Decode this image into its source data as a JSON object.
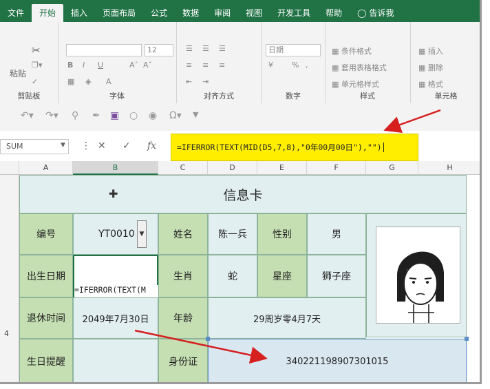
{
  "ribbon": {
    "tabs": [
      "文件",
      "开始",
      "插入",
      "页面布局",
      "公式",
      "数据",
      "审阅",
      "视图",
      "开发工具",
      "帮助",
      "告诉我"
    ],
    "active_tab": "开始",
    "groups": {
      "clipboard": "剪贴板",
      "font": "字体",
      "alignment": "对齐方式",
      "number": "数字",
      "styles": "样式",
      "cells": "单元格"
    },
    "paste_label": "粘贴",
    "font_size": "12",
    "number_format": "日期",
    "conditional_format": "条件格式",
    "table_format": "套用表格格式",
    "cell_styles": "单元格样式",
    "insert": "插入",
    "delete": "删除",
    "format": "格式"
  },
  "formula_bar": {
    "name_box": "SUM",
    "formula": "=IFERROR(TEXT(MID(D5,7,8),\"0年00月00日\"),\"\")"
  },
  "columns": [
    "A",
    "B",
    "C",
    "D",
    "E",
    "F",
    "G",
    "H"
  ],
  "row_number_partial": "4",
  "card": {
    "title": "信息卡",
    "labels": {
      "id_no": "编号",
      "name": "姓名",
      "gender": "性别",
      "birth": "出生日期",
      "zodiac": "生肖",
      "constellation": "星座",
      "retire": "退休时间",
      "age": "年龄",
      "reminder": "生日提醒",
      "id_card": "身份证"
    },
    "values": {
      "id_no": "YT0010",
      "name": "陈一兵",
      "gender": "男",
      "birth_formula": "=IFERROR(TEXT(M",
      "zodiac": "蛇",
      "constellation": "狮子座",
      "retire": "2049年7月30日",
      "age": "29周岁零4月7天",
      "id_card": "340221198907301015"
    }
  },
  "colors": {
    "ribbon": "#217346",
    "callout": "#ffee00",
    "arrow": "#d62020"
  }
}
